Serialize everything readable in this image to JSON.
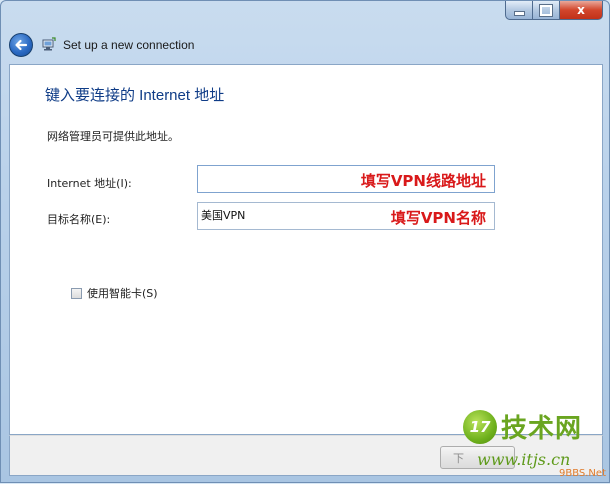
{
  "window": {
    "title": "Set up a new connection",
    "close_glyph": "x"
  },
  "page": {
    "heading": "键入要连接的 Internet 地址",
    "admin_info": "网络管理员可提供此地址。"
  },
  "fields": {
    "internet_address": {
      "label": "Internet 地址(I):",
      "value": "",
      "annotation": "填写VPN线路地址"
    },
    "destination_name": {
      "label": "目标名称(E):",
      "value": "美国VPN",
      "annotation": "填写VPN名称"
    }
  },
  "smart_card": {
    "label": "使用智能卡(S)",
    "checked": false
  },
  "buttons": {
    "next_label": "下"
  },
  "watermark": {
    "logo": "17",
    "text": "技术网",
    "url": "www.itjs.cn",
    "sub": "9BBS.Net"
  },
  "icons": {
    "back": "back-arrow-icon",
    "app": "network-connection-icon",
    "minimize": "minimize-icon",
    "maximize": "maximize-icon",
    "close": "close-icon"
  },
  "colors": {
    "heading": "#0f3c87",
    "annotation": "#d9191a",
    "watermark_green": "#6aa520",
    "close_button": "#d2462c"
  }
}
